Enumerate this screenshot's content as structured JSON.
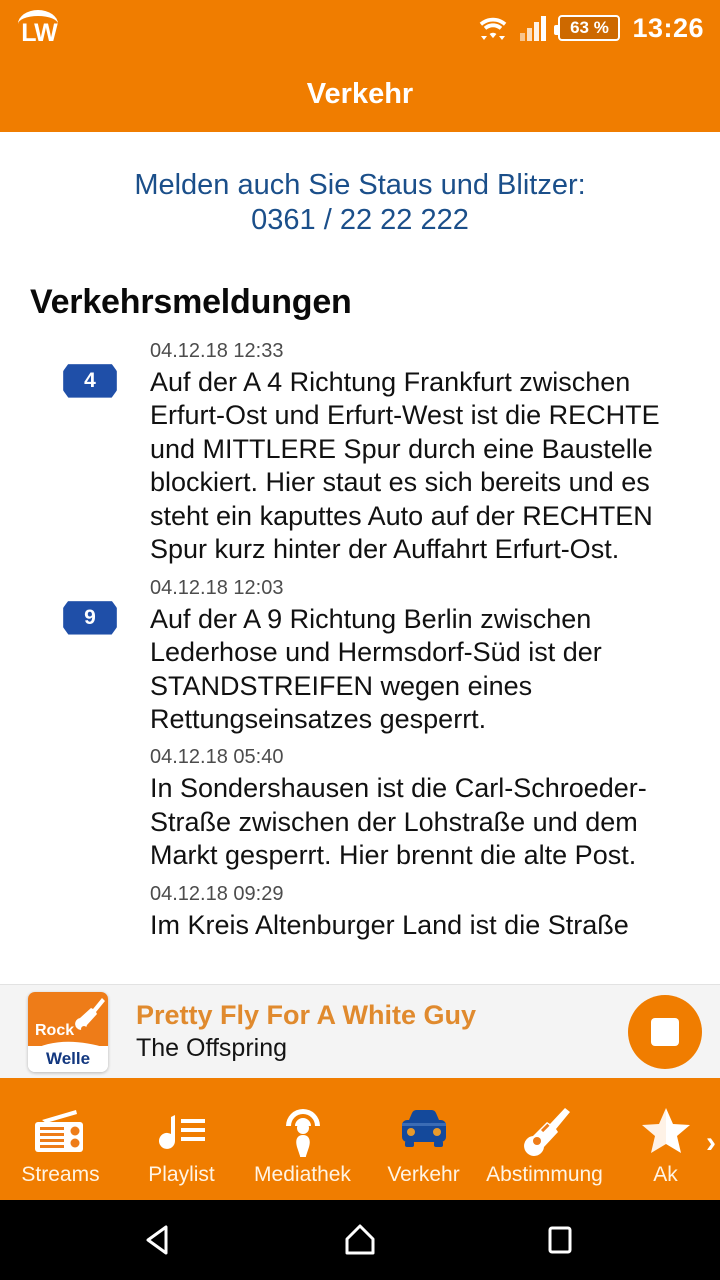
{
  "statusbar": {
    "app_logo_text": "LW",
    "wifi_icon": "wifi-icon",
    "signal_icon": "cellular-signal-icon",
    "battery_level": "63 %",
    "clock": "13:26"
  },
  "appbar": {
    "title": "Verkehr"
  },
  "promo": {
    "line1": "Melden auch Sie Staus und Blitzer:",
    "line2": "0361 / 22 22 222"
  },
  "section": {
    "title": "Verkehrsmeldungen"
  },
  "messages": [
    {
      "badge": "4",
      "time": "04.12.18 12:33",
      "text": "Auf der A 4 Richtung Frankfurt zwischen Erfurt-Ost und Erfurt-West ist die RECHTE und MITTLERE Spur durch eine Baustelle blockiert. Hier staut es sich bereits und es steht ein kaputtes Auto auf der RECHTEN Spur kurz hinter der Auffahrt Erfurt-Ost."
    },
    {
      "badge": "9",
      "time": "04.12.18 12:03",
      "text": "Auf der A 9 Richtung Berlin zwischen Lederhose und Hermsdorf-Süd ist der STANDSTREIFEN wegen eines Rettungseinsatzes gesperrt."
    },
    {
      "badge": "",
      "time": "04.12.18 05:40",
      "text": "In Sondershausen ist die Carl-Schroeder-Straße zwischen der Lohstraße und dem Markt gesperrt. Hier brennt die alte Post."
    },
    {
      "badge": "",
      "time": "04.12.18 09:29",
      "text": "Im Kreis Altenburger Land ist die Straße"
    }
  ],
  "player": {
    "logo_top_text": "Rock",
    "logo_bottom_text": "Welle",
    "logo_guitar_icon": "guitar-icon",
    "track_title": "Pretty Fly For A White Guy",
    "track_artist": "The Offspring",
    "stop_button_label": "stop-icon"
  },
  "tabs": [
    {
      "label": "Streams",
      "icon": "radio-icon"
    },
    {
      "label": "Playlist",
      "icon": "music-note-list-icon"
    },
    {
      "label": "Mediathek",
      "icon": "podcast-icon"
    },
    {
      "label": "Verkehr",
      "icon": "car-icon"
    },
    {
      "label": "Abstimmung",
      "icon": "electric-guitar-icon"
    },
    {
      "label": "Ak",
      "icon": "star-icon"
    }
  ],
  "tab_overflow_indicator": "›",
  "androidnav": {
    "back": "back-triangle-icon",
    "home": "home-icon",
    "recents": "recents-square-icon"
  },
  "colors": {
    "orange": "#F07D00",
    "navy": "#1B4F8A",
    "badge_blue": "#1F4FA8",
    "player_bg": "#F4F4F4",
    "track_title": "#E08A2E"
  }
}
